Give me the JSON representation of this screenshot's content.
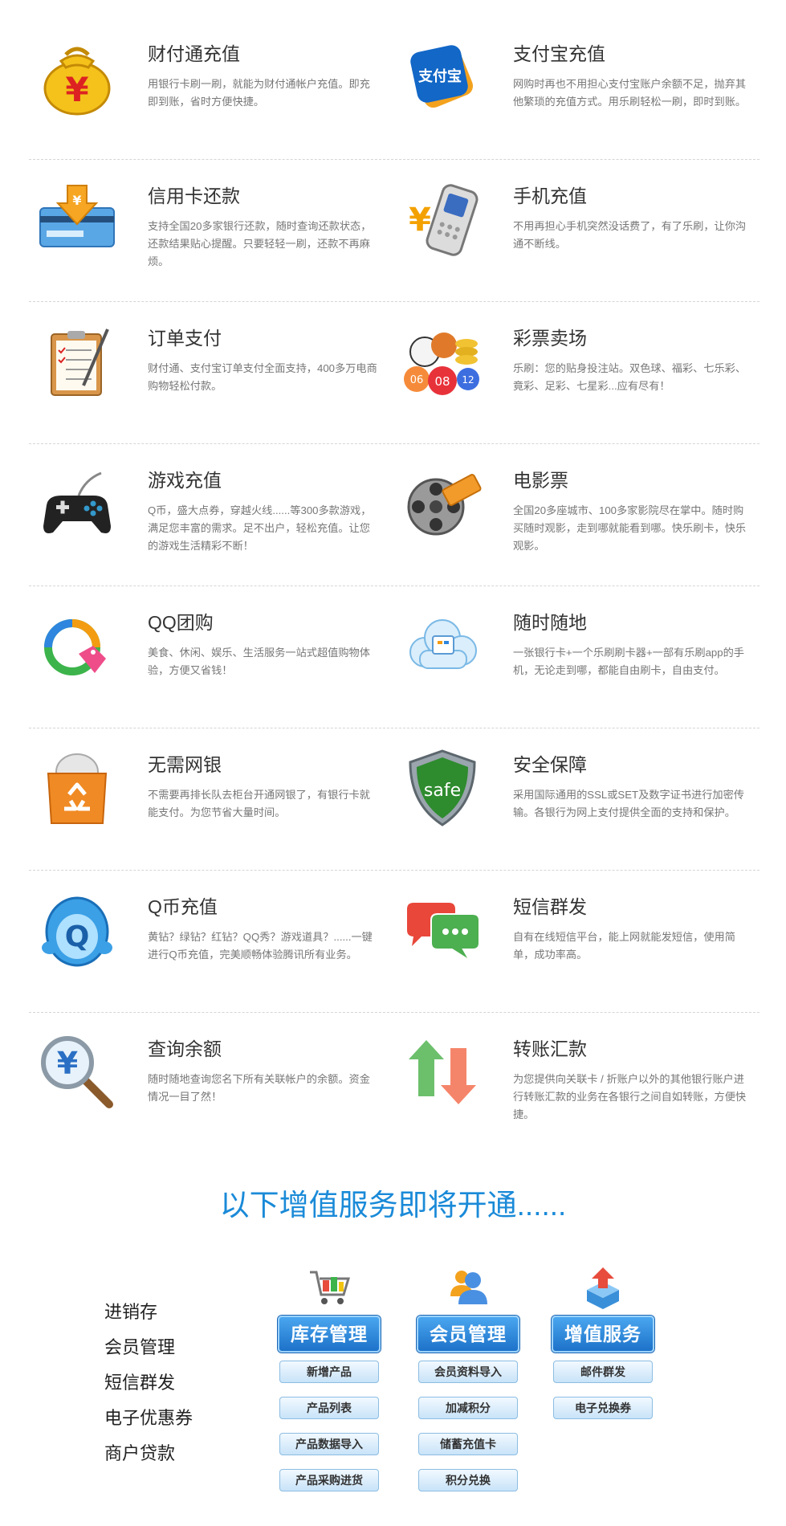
{
  "features": [
    {
      "title": "财付通充值",
      "desc": "用银行卡刷一刷，就能为财付通帐户充值。即充即到账，省时方便快捷。",
      "icon": "money-bag-icon"
    },
    {
      "title": "支付宝充值",
      "desc": "网购时再也不用担心支付宝账户余额不足，抛弃其他繁琐的充值方式。用乐刷轻松一刷，即时到账。",
      "icon": "alipay-icon",
      "icon_text": "支付宝"
    },
    {
      "title": "信用卡还款",
      "desc": "支持全国20多家银行还款，随时查询还款状态，还款结果贴心提醒。只要轻轻一刷，还款不再麻烦。",
      "icon": "credit-card-icon"
    },
    {
      "title": "手机充值",
      "desc": "不用再担心手机突然没话费了，有了乐刷，让你沟通不断线。",
      "icon": "mobile-phone-icon"
    },
    {
      "title": "订单支付",
      "desc": "财付通、支付宝订单支付全面支持，400多万电商购物轻松付款。",
      "icon": "clipboard-icon"
    },
    {
      "title": "彩票卖场",
      "desc": "乐刷：您的贴身投注站。双色球、福彩、七乐彩、竟彩、足彩、七星彩...应有尽有！",
      "icon": "lottery-balls-icon",
      "icon_text": [
        "06",
        "08",
        "12"
      ]
    },
    {
      "title": "游戏充值",
      "desc": "Q币，盛大点券，穿越火线......等300多款游戏，满足您丰富的需求。足不出户，轻松充值。让您的游戏生活精彩不断！",
      "icon": "gamepad-icon"
    },
    {
      "title": "电影票",
      "desc": "全国20多座城市、100多家影院尽在掌中。随时购买随时观影，走到哪就能看到哪。快乐刷卡，快乐观影。",
      "icon": "film-reel-icon"
    },
    {
      "title": "QQ团购",
      "desc": "美食、休闲、娱乐、生活服务一站式超值购物体验，方便又省钱！",
      "icon": "qq-group-buy-icon"
    },
    {
      "title": "随时随地",
      "desc": "一张银行卡+一个乐刷刷卡器+一部有乐刷app的手机，无论走到哪，都能自由刷卡，自由支付。",
      "icon": "cloud-icon"
    },
    {
      "title": "无需网银",
      "desc": "不需要再排长队去柜台开通网银了，有银行卡就能支付。为您节省大量时间。",
      "icon": "recycle-box-icon"
    },
    {
      "title": "安全保障",
      "desc": "采用国际通用的SSL或SET及数字证书进行加密传输。各银行为网上支付提供全面的支持和保护。",
      "icon": "shield-icon",
      "icon_text": "safe"
    },
    {
      "title": "Q币充值",
      "desc": "黄钻？绿钻？红钻？QQ秀？游戏道具？......一键进行Q币充值，完美顺畅体验腾讯所有业务。",
      "icon": "qq-penguin-icon",
      "icon_text": "Q"
    },
    {
      "title": "短信群发",
      "desc": "自有在线短信平台，能上网就能发短信，使用简单，成功率高。",
      "icon": "chat-bubbles-icon"
    },
    {
      "title": "查询余额",
      "desc": "随时随地查询您名下所有关联帐户的余额。资金情况一目了然！",
      "icon": "magnifier-icon"
    },
    {
      "title": "转账汇款",
      "desc": "为您提供向关联卡 / 折账户以外的其他银行账户进行转账汇款的业务在各银行之间自如转账，方便快捷。",
      "icon": "transfer-arrows-icon"
    }
  ],
  "coming_soon": "以下增值服务即将开通......",
  "upcoming_services": [
    "进销存",
    "会员管理",
    "短信群发",
    "电子优惠券",
    "商户贷款"
  ],
  "modules": [
    {
      "title": "库存管理",
      "icon": "shopping-cart-icon",
      "items": [
        "新增产品",
        "产品列表",
        "产品数据导入",
        "产品采购进货"
      ]
    },
    {
      "title": "会员管理",
      "icon": "members-icon",
      "items": [
        "会员资料导入",
        "加减积分",
        "储蓄充值卡",
        "积分兑换"
      ]
    },
    {
      "title": "增值服务",
      "icon": "upload-box-icon",
      "items": [
        "邮件群发",
        "电子兑换券"
      ]
    }
  ],
  "colors": {
    "accent": "#1a8ad8",
    "button_blue": "#1d72c9",
    "divider": "#d5d5d5"
  }
}
